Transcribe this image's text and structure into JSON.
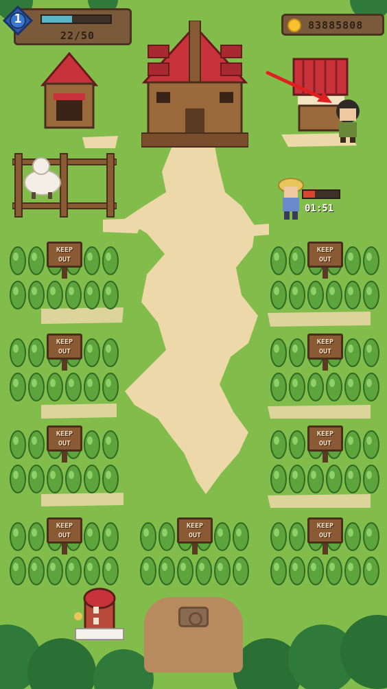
{
  "hud": {
    "level": "1",
    "xp_text": "22/50",
    "xp_fraction": 0.44,
    "coins": "83885808",
    "coin_icon": "coin-icon",
    "level_icon": "level-badge-icon"
  },
  "farmer": {
    "timer": "01:51",
    "progress_fraction": 0.32
  },
  "plots": [
    {
      "sign_line1": "KEEP",
      "sign_line2": "OUT"
    },
    {
      "sign_line1": "KEEP",
      "sign_line2": "OUT"
    },
    {
      "sign_line1": "KEEP",
      "sign_line2": "OUT"
    },
    {
      "sign_line1": "KEEP",
      "sign_line2": "OUT"
    },
    {
      "sign_line1": "KEEP",
      "sign_line2": "OUT"
    },
    {
      "sign_line1": "KEEP",
      "sign_line2": "OUT"
    },
    {
      "sign_line1": "KEEP",
      "sign_line2": "OUT"
    },
    {
      "sign_line1": "KEEP",
      "sign_line2": "OUT"
    },
    {
      "sign_line1": "KEEP",
      "sign_line2": "OUT"
    }
  ],
  "colors": {
    "grass": "#82bd4c",
    "path": "#ecd8a8",
    "roof": "#c8323a",
    "wood": "#8a5a35",
    "xp_bar": "#58b6c6",
    "timer_bar": "#d9442c",
    "arrow": "#e02020"
  },
  "icons": {
    "camera": "camera-icon",
    "arrow": "pointer-arrow-icon"
  }
}
